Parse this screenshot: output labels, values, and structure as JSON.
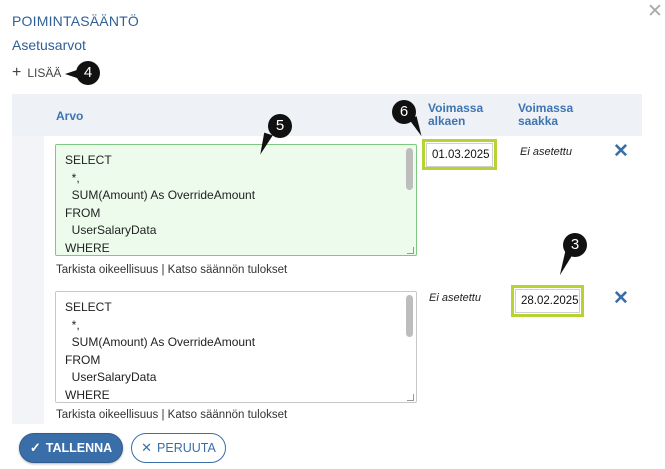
{
  "dialog": {
    "title": "POIMINTASÄÄNTÖ",
    "subtitle": "Asetusarvot",
    "close_icon": "✕"
  },
  "toolbar": {
    "add_icon": "+",
    "add_label": "LISÄÄ"
  },
  "annotations": {
    "b4": "4",
    "b5": "5",
    "b6": "6",
    "b3": "3"
  },
  "table": {
    "headers": {
      "value": "Arvo",
      "valid_from": "Voimassa alkaen",
      "valid_to": "Voimassa saakka"
    },
    "rows": [
      {
        "code": "SELECT\n  *,\n  SUM(Amount) As OverrideAmount\nFROM\n  UserSalaryData\nWHERE",
        "check_link": "Tarkista oikeellisuus",
        "separator": " | ",
        "results_link": "Katso säännön tulokset",
        "valid_from": "01.03.2025",
        "valid_to": "Ei asetettu"
      },
      {
        "code": "SELECT\n  *,\n  SUM(Amount) As OverrideAmount\nFROM\n  UserSalaryData\nWHERE",
        "check_link": "Tarkista oikeellisuus",
        "separator": " | ",
        "results_link": "Katso säännön tulokset",
        "valid_from": "Ei asetettu",
        "valid_to": "28.02.2025"
      }
    ],
    "delete_icon": "✕"
  },
  "footer": {
    "save_icon": "✓",
    "save_label": "TALLENNA",
    "cancel_icon": "✕",
    "cancel_label": "PERUUTA"
  },
  "colors": {
    "accent": "#3a6ea8",
    "highlight": "#b5d433",
    "active_editor": "#edfbed"
  }
}
